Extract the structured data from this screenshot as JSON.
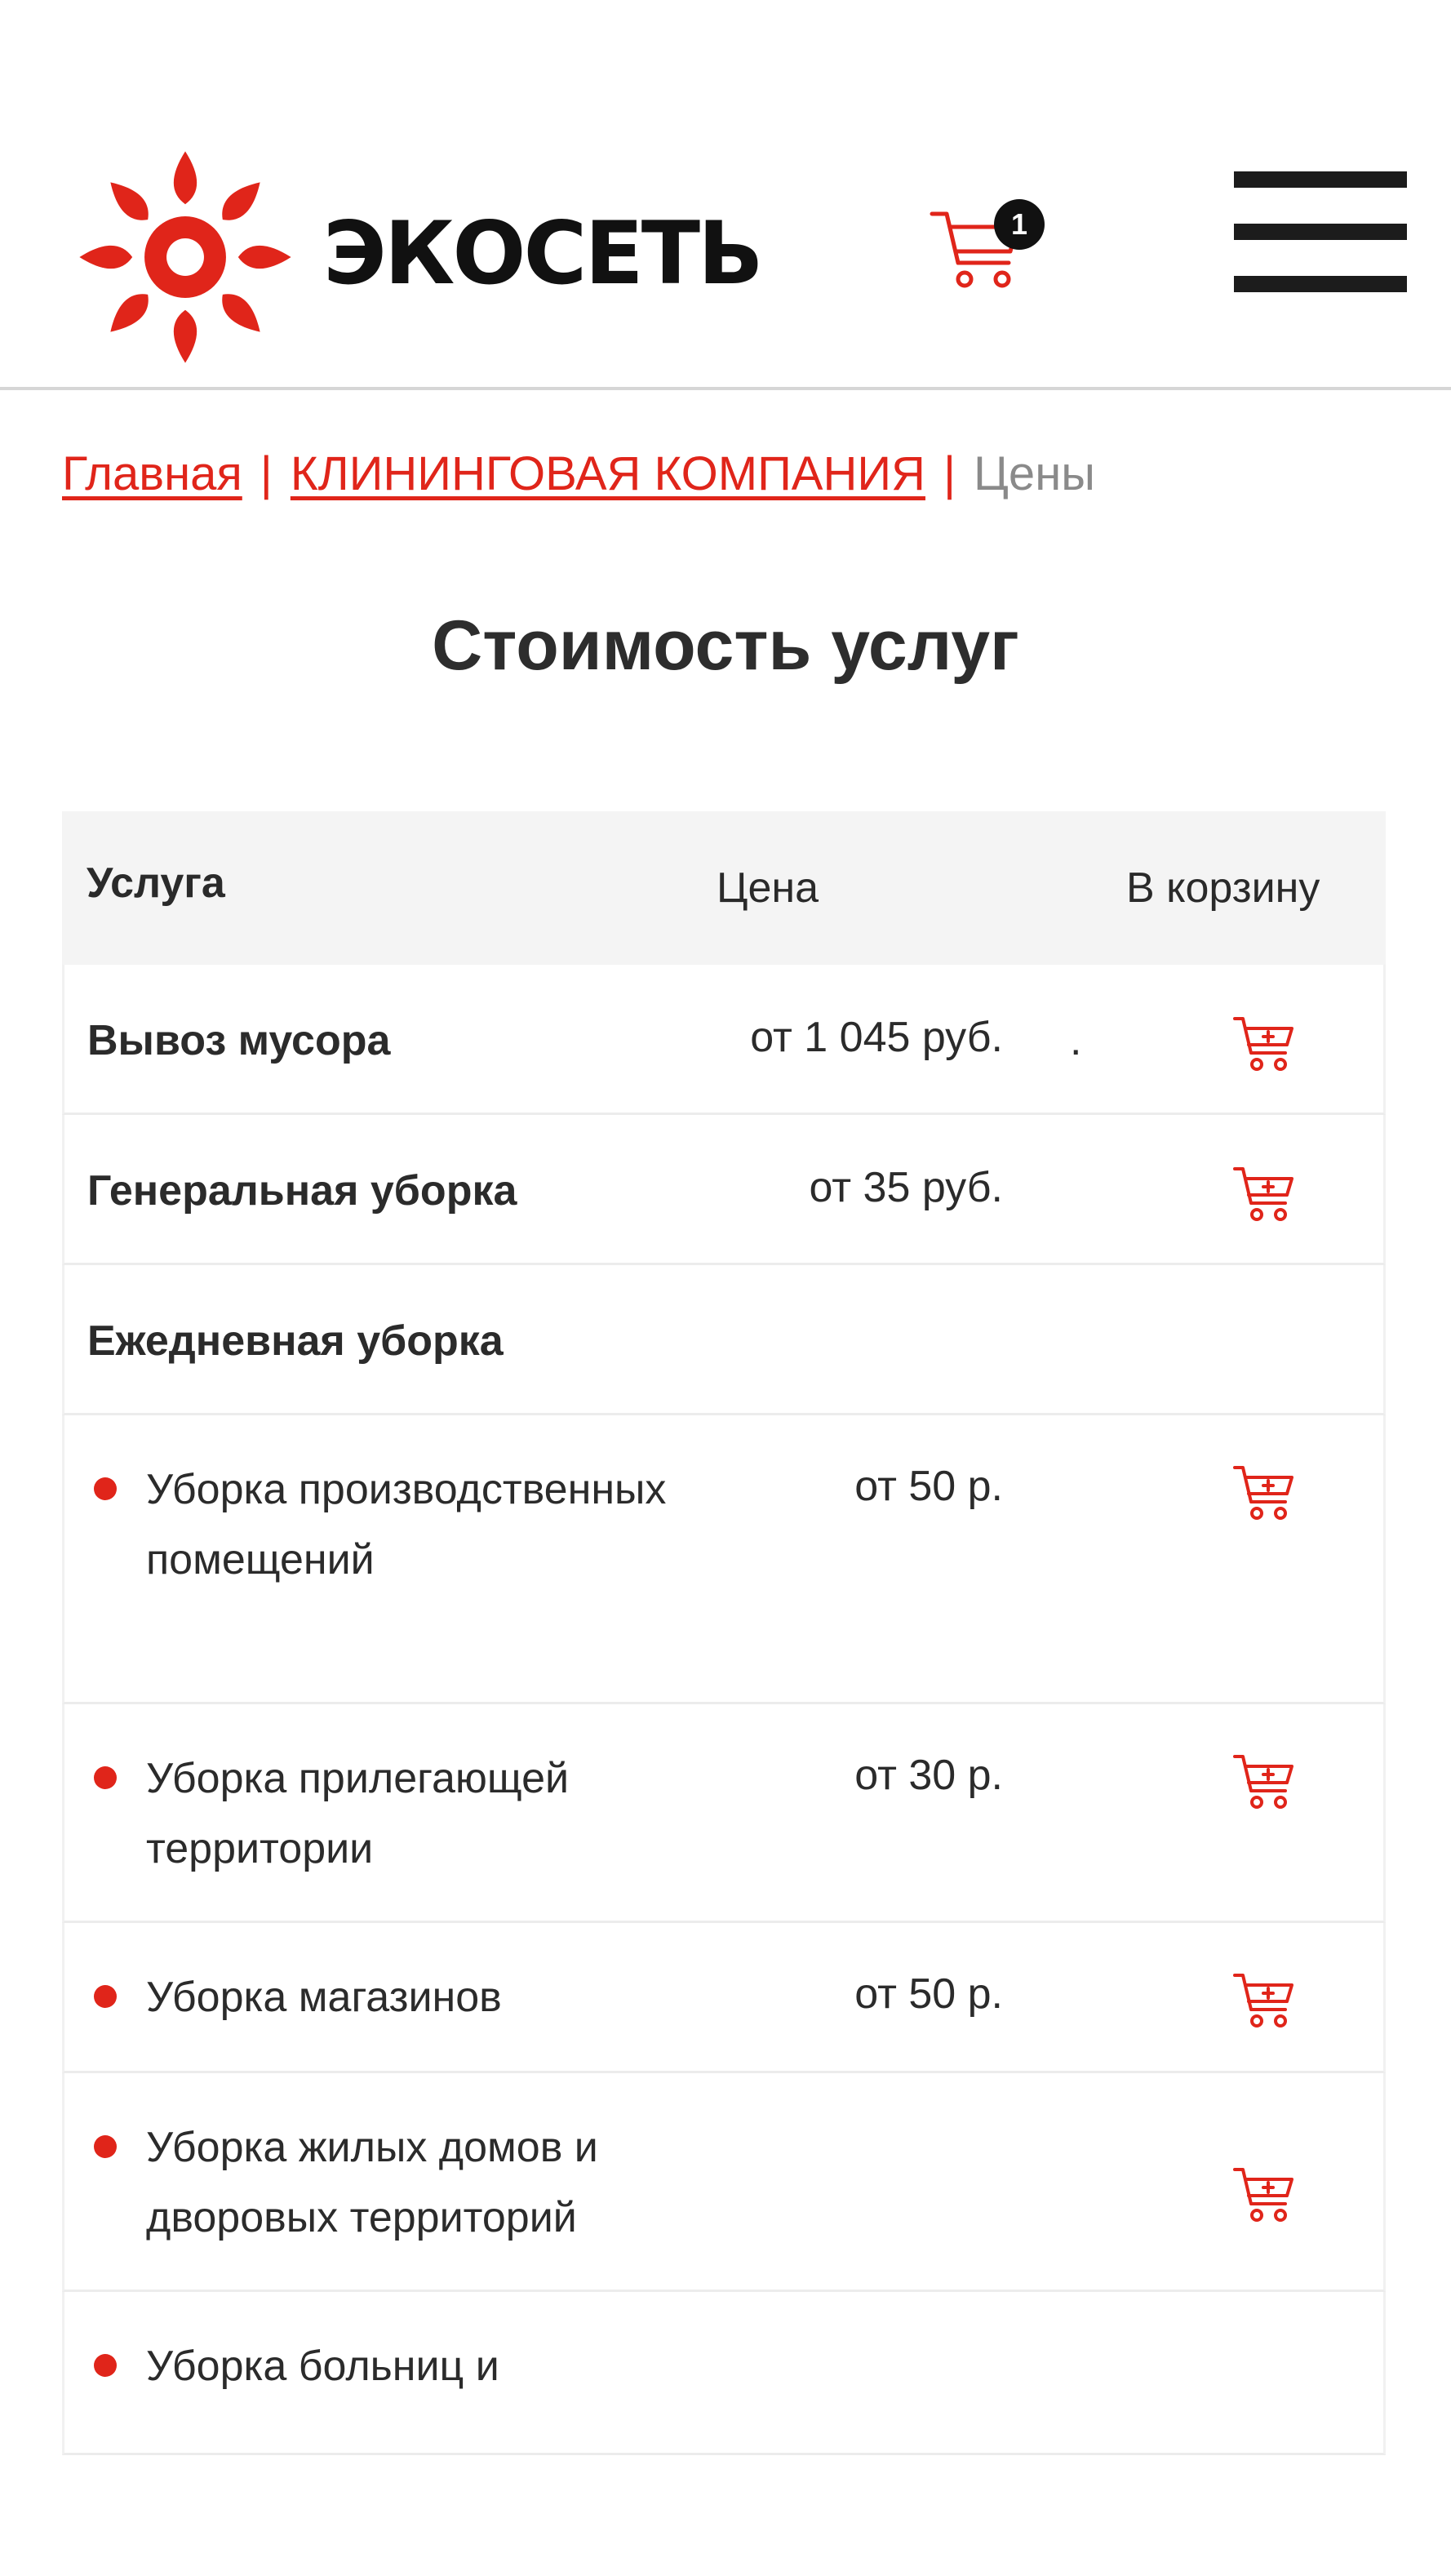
{
  "header": {
    "logo_text": "ЭКОСЕТЬ",
    "cart_count": "1",
    "brand_color": "#e0251a"
  },
  "breadcrumb": {
    "home": "Главная",
    "section": "КЛИНИНГОВАЯ КОМПАНИЯ",
    "separator": "|",
    "current": "Цены"
  },
  "page_title": "Стоимость услуг",
  "table": {
    "columns": [
      "Услуга",
      "Цена",
      "В корзину"
    ],
    "rows": [
      {
        "name": "Вывоз мусора",
        "price": "от 1 045 руб.",
        "style": "bold",
        "cart": true
      },
      {
        "name": "Генеральная уборка",
        "price": "от 35 руб.",
        "style": "bold",
        "cart": true
      },
      {
        "name": "Ежедневная уборка",
        "price": "",
        "style": "bold",
        "cart": false
      },
      {
        "name": "Уборка производственных помещений",
        "price": "от 50 р.",
        "style": "bullet",
        "cart": true
      },
      {
        "name": "Уборка прилегающей территории",
        "price": "от 30 р.",
        "style": "bullet",
        "cart": true
      },
      {
        "name": "Уборка магазинов",
        "price": "от 50 р.",
        "style": "bullet",
        "cart": true
      },
      {
        "name": "Уборка жилых домов и дворовых территорий",
        "price": "",
        "style": "bullet",
        "cart": true
      },
      {
        "name": "Уборка больниц и",
        "price": "",
        "style": "bullet",
        "cart": false
      }
    ],
    "stray_mark": "."
  }
}
